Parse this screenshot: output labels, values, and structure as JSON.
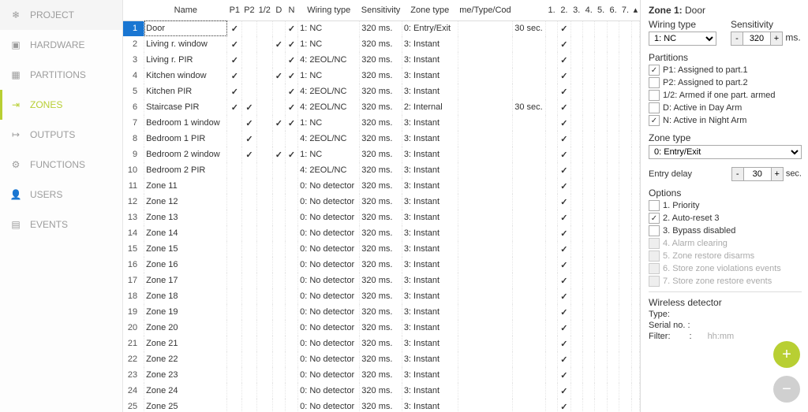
{
  "sidebar": {
    "items": [
      {
        "label": "PROJECT",
        "icon": "project-icon"
      },
      {
        "label": "HARDWARE",
        "icon": "hardware-icon"
      },
      {
        "label": "PARTITIONS",
        "icon": "partitions-icon"
      },
      {
        "label": "ZONES",
        "icon": "zones-icon",
        "active": true
      },
      {
        "label": "OUTPUTS",
        "icon": "outputs-icon"
      },
      {
        "label": "FUNCTIONS",
        "icon": "functions-icon"
      },
      {
        "label": "USERS",
        "icon": "users-icon"
      },
      {
        "label": "EVENTS",
        "icon": "events-icon"
      }
    ]
  },
  "table": {
    "headers": {
      "name": "Name",
      "p1": "P1",
      "p2": "P2",
      "half": "1/2",
      "d": "D",
      "n": "N",
      "wiring": "Wiring type",
      "sens": "Sensitivity",
      "ztype": "Zone type",
      "alarmcode": "me/Type/Cod",
      "entry": "",
      "o1": "1.",
      "o2": "2.",
      "o3": "3.",
      "o4": "4.",
      "o5": "5.",
      "o6": "6.",
      "o7": "7."
    },
    "rows": [
      {
        "n": 1,
        "name": "Door",
        "p1": true,
        "p2": false,
        "half": false,
        "d": false,
        "n_": true,
        "wt": "1: NC",
        "sens": "320 ms.",
        "zt": "0: Entry/Exit",
        "ac": "",
        "ed": "30 sec.",
        "o2": true,
        "sel": true
      },
      {
        "n": 2,
        "name": "Living r. window",
        "p1": true,
        "p2": false,
        "half": false,
        "d": true,
        "n_": true,
        "wt": "1: NC",
        "sens": "320 ms.",
        "zt": "3: Instant",
        "ac": "",
        "ed": "",
        "o2": true
      },
      {
        "n": 3,
        "name": "Living r. PIR",
        "p1": true,
        "p2": false,
        "half": false,
        "d": false,
        "n_": true,
        "wt": "4: 2EOL/NC",
        "sens": "320 ms.",
        "zt": "3: Instant",
        "ac": "",
        "ed": "",
        "o2": true
      },
      {
        "n": 4,
        "name": "Kitchen window",
        "p1": true,
        "p2": false,
        "half": false,
        "d": true,
        "n_": true,
        "wt": "1: NC",
        "sens": "320 ms.",
        "zt": "3: Instant",
        "ac": "",
        "ed": "",
        "o2": true
      },
      {
        "n": 5,
        "name": "Kitchen PIR",
        "p1": true,
        "p2": false,
        "half": false,
        "d": false,
        "n_": true,
        "wt": "4: 2EOL/NC",
        "sens": "320 ms.",
        "zt": "3: Instant",
        "ac": "",
        "ed": "",
        "o2": true
      },
      {
        "n": 6,
        "name": "Staircase PIR",
        "p1": true,
        "p2": true,
        "half": false,
        "d": false,
        "n_": true,
        "wt": "4: 2EOL/NC",
        "sens": "320 ms.",
        "zt": "2: Internal",
        "ac": "",
        "ed": "30 sec.",
        "o2": true
      },
      {
        "n": 7,
        "name": "Bedroom 1 window",
        "p1": false,
        "p2": true,
        "half": false,
        "d": true,
        "n_": true,
        "wt": "1: NC",
        "sens": "320 ms.",
        "zt": "3: Instant",
        "ac": "",
        "ed": "",
        "o2": true
      },
      {
        "n": 8,
        "name": "Bedroom 1 PIR",
        "p1": false,
        "p2": true,
        "half": false,
        "d": false,
        "n_": false,
        "wt": "4: 2EOL/NC",
        "sens": "320 ms.",
        "zt": "3: Instant",
        "ac": "",
        "ed": "",
        "o2": true
      },
      {
        "n": 9,
        "name": "Bedroom 2 window",
        "p1": false,
        "p2": true,
        "half": false,
        "d": true,
        "n_": true,
        "wt": "1: NC",
        "sens": "320 ms.",
        "zt": "3: Instant",
        "ac": "",
        "ed": "",
        "o2": true
      },
      {
        "n": 10,
        "name": "Bedroom 2 PIR",
        "p1": false,
        "p2": false,
        "half": false,
        "d": false,
        "n_": false,
        "wt": "4: 2EOL/NC",
        "sens": "320 ms.",
        "zt": "3: Instant",
        "ac": "",
        "ed": "",
        "o2": true
      },
      {
        "n": 11,
        "name": "Zone 11",
        "wt": "0: No detector",
        "sens": "320 ms.",
        "zt": "3: Instant",
        "o2": true
      },
      {
        "n": 12,
        "name": "Zone 12",
        "wt": "0: No detector",
        "sens": "320 ms.",
        "zt": "3: Instant",
        "o2": true
      },
      {
        "n": 13,
        "name": "Zone 13",
        "wt": "0: No detector",
        "sens": "320 ms.",
        "zt": "3: Instant",
        "o2": true
      },
      {
        "n": 14,
        "name": "Zone 14",
        "wt": "0: No detector",
        "sens": "320 ms.",
        "zt": "3: Instant",
        "o2": true
      },
      {
        "n": 15,
        "name": "Zone 15",
        "wt": "0: No detector",
        "sens": "320 ms.",
        "zt": "3: Instant",
        "o2": true
      },
      {
        "n": 16,
        "name": "Zone 16",
        "wt": "0: No detector",
        "sens": "320 ms.",
        "zt": "3: Instant",
        "o2": true
      },
      {
        "n": 17,
        "name": "Zone 17",
        "wt": "0: No detector",
        "sens": "320 ms.",
        "zt": "3: Instant",
        "o2": true
      },
      {
        "n": 18,
        "name": "Zone 18",
        "wt": "0: No detector",
        "sens": "320 ms.",
        "zt": "3: Instant",
        "o2": true
      },
      {
        "n": 19,
        "name": "Zone 19",
        "wt": "0: No detector",
        "sens": "320 ms.",
        "zt": "3: Instant",
        "o2": true
      },
      {
        "n": 20,
        "name": "Zone 20",
        "wt": "0: No detector",
        "sens": "320 ms.",
        "zt": "3: Instant",
        "o2": true
      },
      {
        "n": 21,
        "name": "Zone 21",
        "wt": "0: No detector",
        "sens": "320 ms.",
        "zt": "3: Instant",
        "o2": true
      },
      {
        "n": 22,
        "name": "Zone 22",
        "wt": "0: No detector",
        "sens": "320 ms.",
        "zt": "3: Instant",
        "o2": true
      },
      {
        "n": 23,
        "name": "Zone 23",
        "wt": "0: No detector",
        "sens": "320 ms.",
        "zt": "3: Instant",
        "o2": true
      },
      {
        "n": 24,
        "name": "Zone 24",
        "wt": "0: No detector",
        "sens": "320 ms.",
        "zt": "3: Instant",
        "o2": true
      },
      {
        "n": 25,
        "name": "Zone 25",
        "wt": "0: No detector",
        "sens": "320 ms.",
        "zt": "3: Instant",
        "o2": true
      }
    ]
  },
  "detail": {
    "title_prefix": "Zone 1:",
    "title_name": "Door",
    "wiring_label": "Wiring type",
    "wiring_value": "1: NC",
    "sens_label": "Sensitivity",
    "sens_value": "320",
    "sens_unit": "ms.",
    "partitions_label": "Partitions",
    "partitions": [
      {
        "checked": true,
        "label": "P1: Assigned to part.1"
      },
      {
        "checked": false,
        "label": "P2: Assigned to part.2"
      },
      {
        "checked": false,
        "label": "1/2: Armed if one part. armed"
      },
      {
        "checked": false,
        "label": "D: Active in Day Arm"
      },
      {
        "checked": true,
        "label": "N: Active in Night Arm"
      }
    ],
    "ztype_label": "Zone type",
    "ztype_value": "0: Entry/Exit",
    "entry_label": "Entry delay",
    "entry_value": "30",
    "entry_unit": "sec.",
    "options_label": "Options",
    "options": [
      {
        "checked": false,
        "label": "1. Priority"
      },
      {
        "checked": true,
        "label": "2. Auto-reset 3"
      },
      {
        "checked": false,
        "label": "3. Bypass disabled"
      },
      {
        "checked": false,
        "label": "4. Alarm clearing",
        "disabled": true
      },
      {
        "checked": false,
        "label": "5. Zone restore disarms",
        "disabled": true
      },
      {
        "checked": false,
        "label": "6. Store zone violations events",
        "disabled": true
      },
      {
        "checked": false,
        "label": "7. Store zone restore events",
        "disabled": true
      }
    ],
    "wireless_label": "Wireless detector",
    "wireless_type_label": "Type:",
    "wireless_serial_label": "Serial no. :",
    "wireless_filter_label": "Filter:",
    "wireless_filter_sep": ":",
    "wireless_filter_hint": "hh:mm",
    "minus": "-",
    "plus": "+"
  }
}
